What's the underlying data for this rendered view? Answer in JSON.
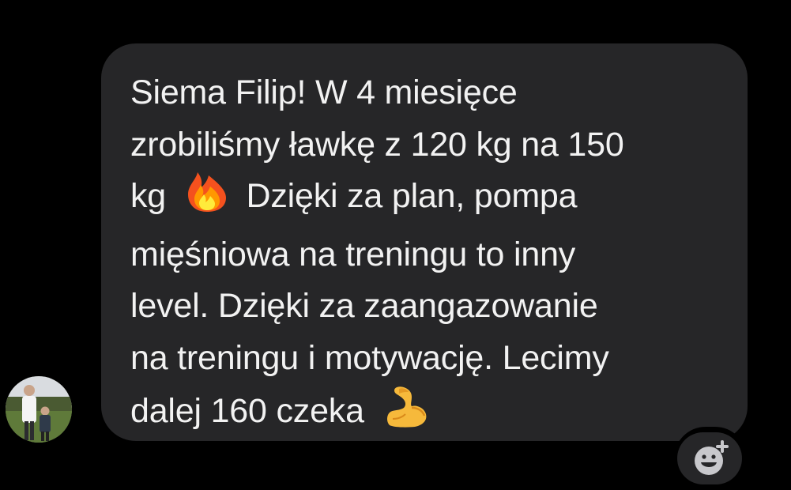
{
  "message": {
    "lines": [
      "Siema Filip! W 4 miesięce",
      "zrobiliśmy ławkę z 120 kg na 150",
      "kg",
      "Dzięki za plan, pompa",
      "mięśniowa na treningu to inny",
      "level. Dzięki za zaangazowanie",
      "na treningu i motywację. Lecimy",
      "dalej 160 czeka"
    ],
    "emojis": [
      "fire-emoji",
      "flexed-biceps-emoji"
    ]
  },
  "sender": {
    "avatar_icon": "avatar"
  },
  "reaction": {
    "icon": "add-reaction-icon"
  },
  "colors": {
    "background": "#000000",
    "bubble": "#262628",
    "text": "#f2f2f2"
  }
}
